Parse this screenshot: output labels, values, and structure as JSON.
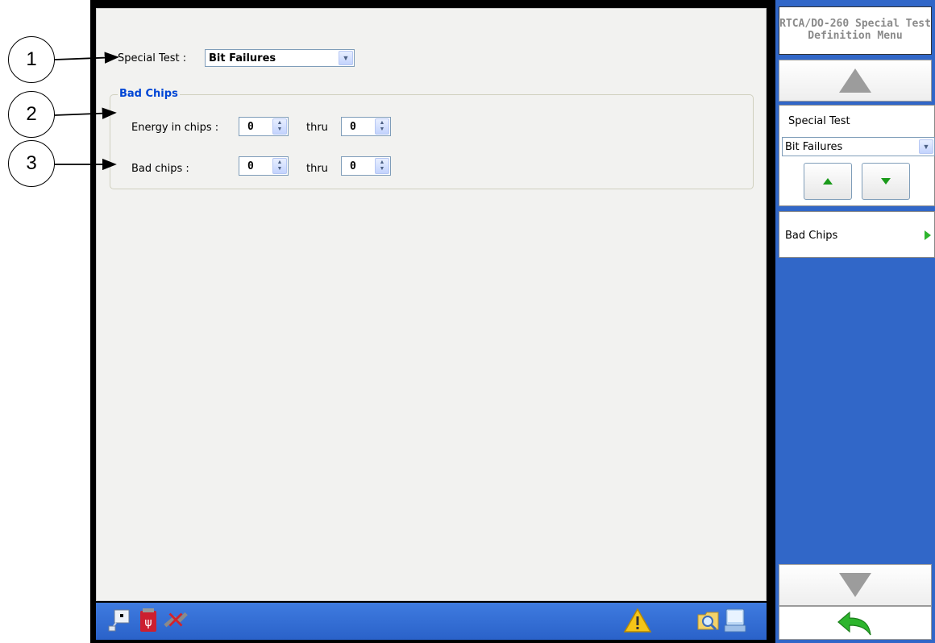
{
  "callouts": [
    "1",
    "2",
    "3"
  ],
  "main": {
    "special_test_label": "Special Test :",
    "special_test_value": "Bit Failures",
    "group_title": "Bad Chips",
    "energy_label": "Energy in chips :",
    "energy_from": "0",
    "energy_thru_label": "thru",
    "energy_to": "0",
    "bad_chips_label": "Bad chips :",
    "bad_from": "0",
    "bad_thru_label": "thru",
    "bad_to": "0"
  },
  "taskbar": {
    "left_icons": [
      "network-icon",
      "usb-icon",
      "disconnect-icon"
    ],
    "right_icons": [
      "warning-icon",
      "file-browser-icon",
      "keyboard-icon"
    ]
  },
  "menu": {
    "title": "RTCA/DO-260 Special Test Definition Menu",
    "special_test_label": "Special Test",
    "special_test_value": "Bit Failures",
    "bad_chips_item": "Bad Chips"
  },
  "colors": {
    "menu_blue": "#3167c8",
    "taskbar_blue": "#2a62c9",
    "group_title": "#0046d5",
    "green_arrow": "#2db52d"
  }
}
